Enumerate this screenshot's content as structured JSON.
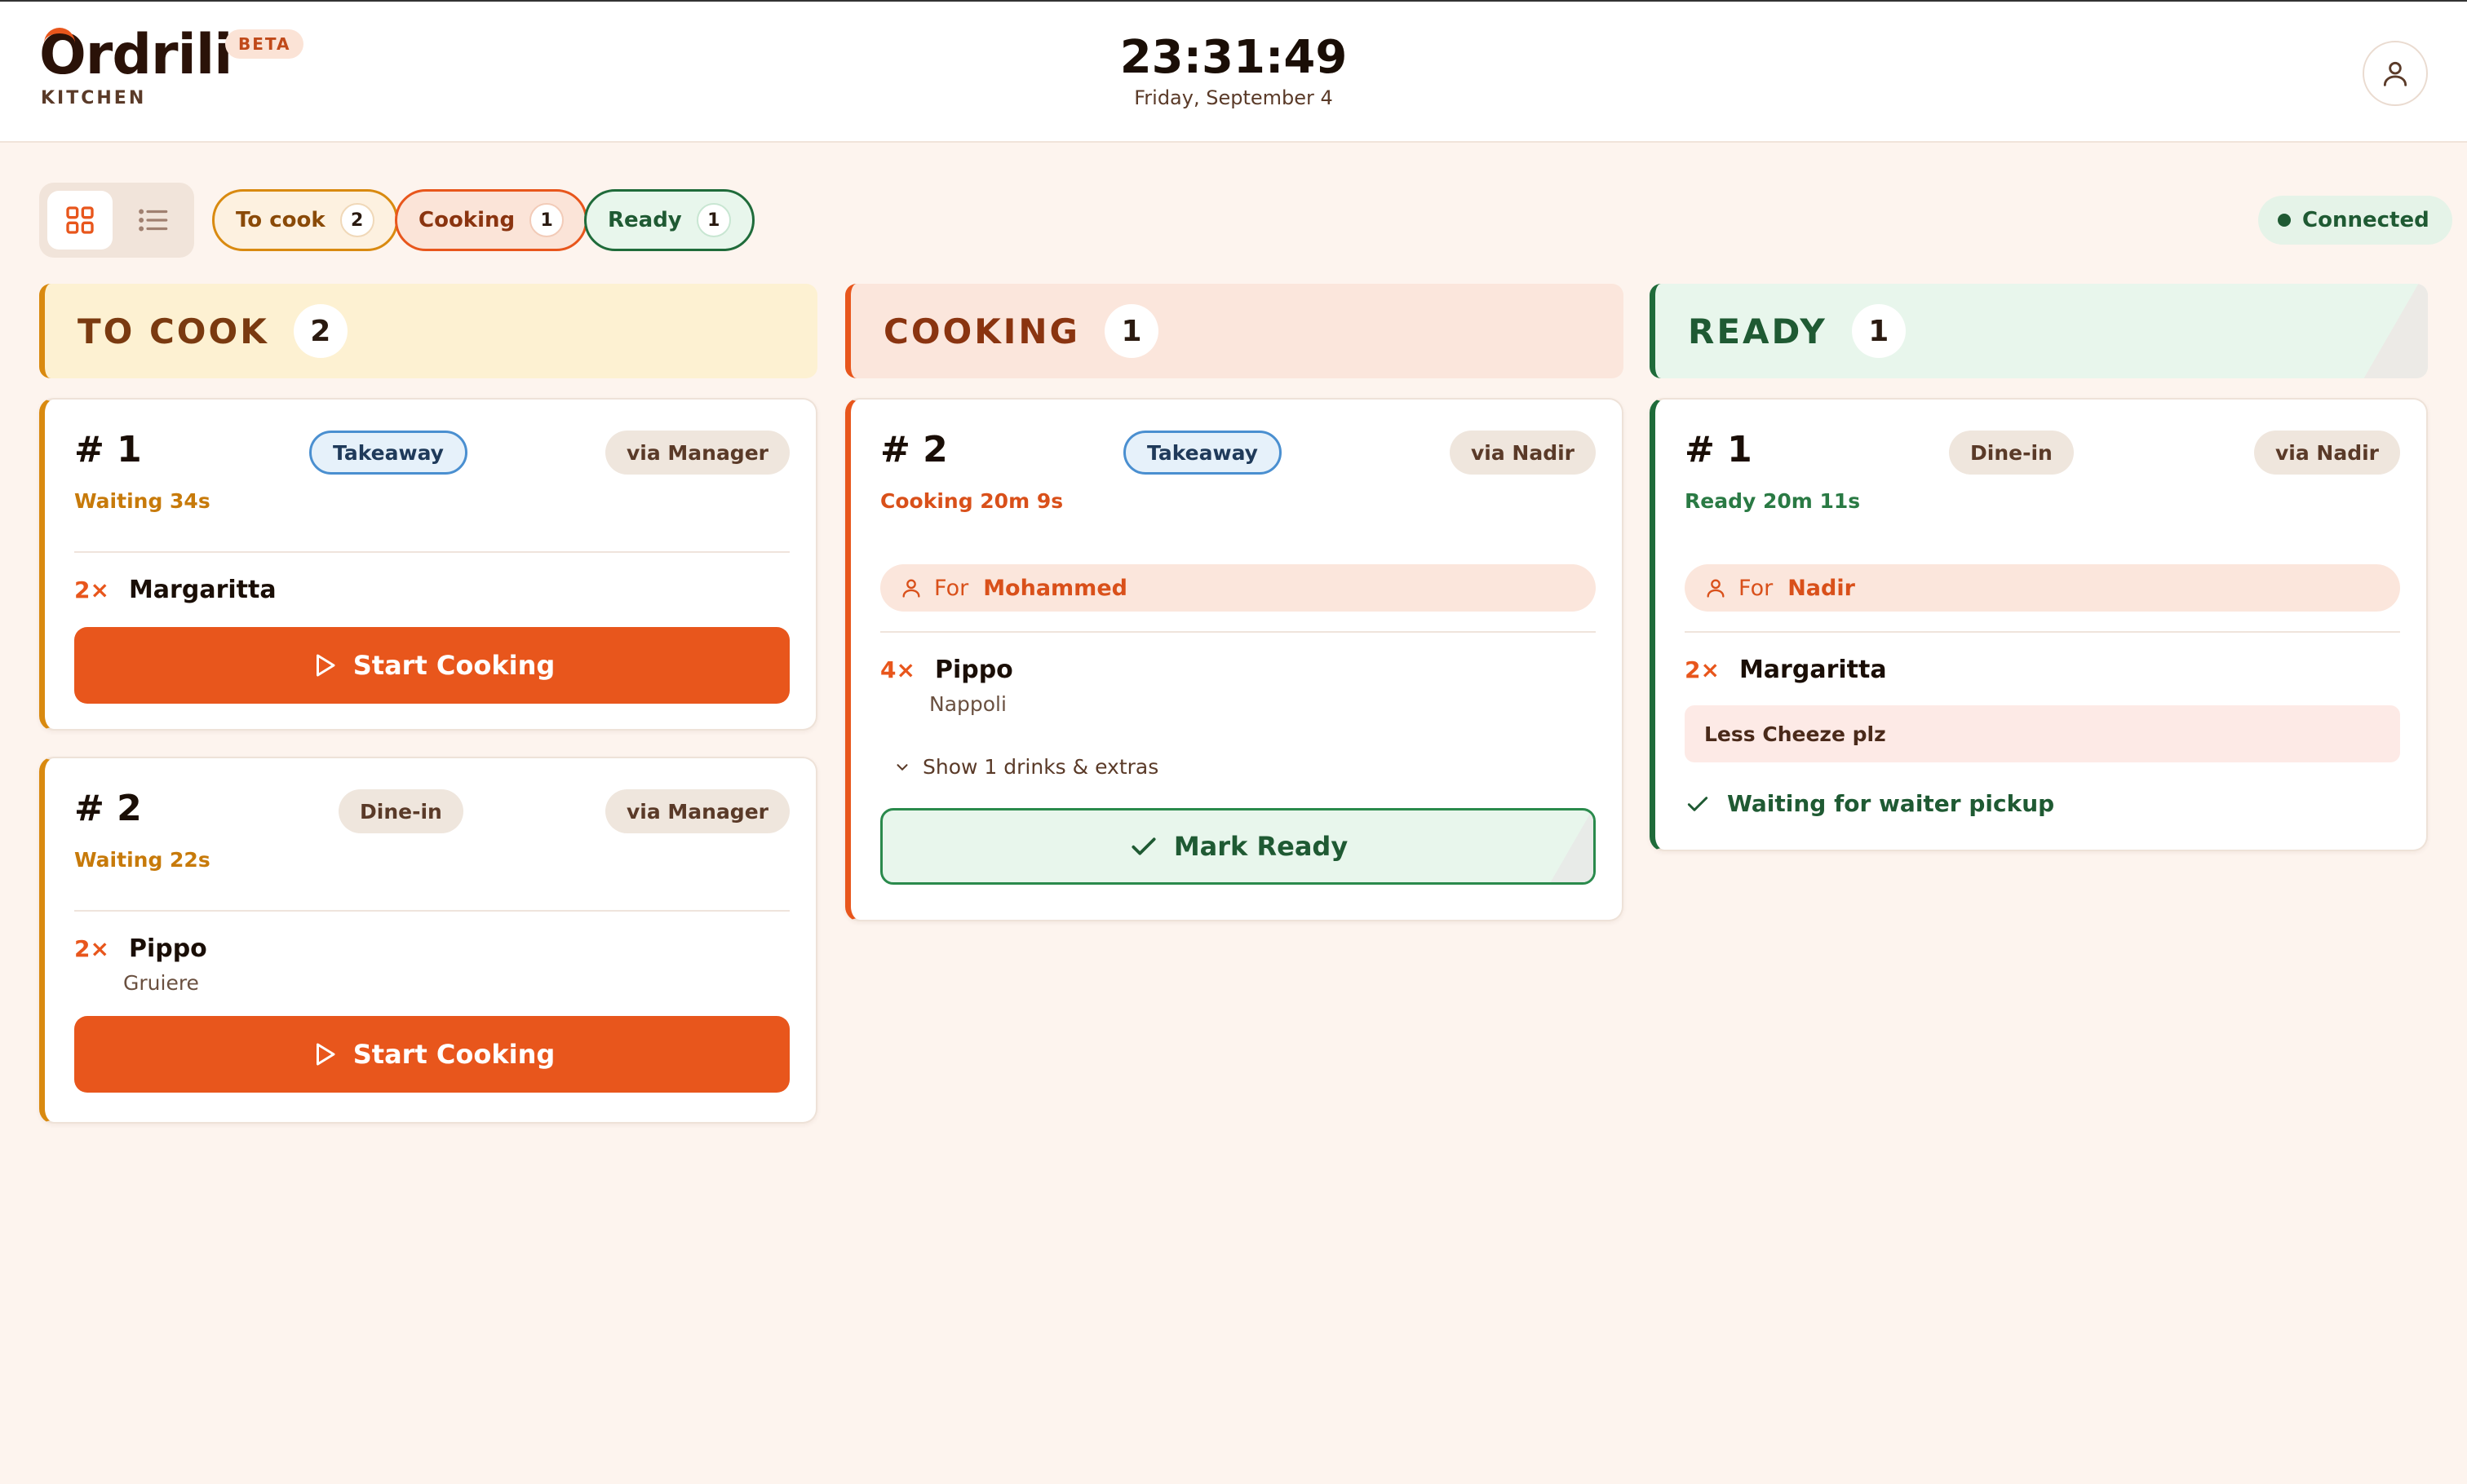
{
  "header": {
    "brand": "Ordrili",
    "beta": "BETA",
    "subtitle": "KITCHEN",
    "time": "23:31:49",
    "date": "Friday, September 4",
    "user_icon": "user-icon"
  },
  "toolbar": {
    "view_modes": [
      "grid-icon",
      "list-icon"
    ],
    "filters": [
      {
        "label": "To cook",
        "count": "2"
      },
      {
        "label": "Cooking",
        "count": "1"
      },
      {
        "label": "Ready",
        "count": "1"
      }
    ],
    "connection": "Connected"
  },
  "columns": {
    "tocook": {
      "title": "TO COOK",
      "count": "2"
    },
    "cooking": {
      "title": "COOKING",
      "count": "1"
    },
    "ready": {
      "title": "READY",
      "count": "1"
    }
  },
  "orders": {
    "tocook1": {
      "number": "# 1",
      "type": "Takeaway",
      "via": "via Manager",
      "status": "Waiting 34s",
      "items": [
        {
          "qty": "2×",
          "name": "Margaritta"
        }
      ],
      "action": "Start Cooking"
    },
    "tocook2": {
      "number": "# 2",
      "type": "Dine-in",
      "via": "via Manager",
      "status": "Waiting 22s",
      "items": [
        {
          "qty": "2×",
          "name": "Pippo",
          "sub": "Gruiere"
        }
      ],
      "action": "Start Cooking"
    },
    "cooking1": {
      "number": "# 2",
      "type": "Takeaway",
      "via": "via Nadir",
      "status": "Cooking 20m 9s",
      "for_label": "For",
      "for_name": "Mohammed",
      "items": [
        {
          "qty": "4×",
          "name": "Pippo",
          "sub": "Nappoli"
        }
      ],
      "extras": "Show 1 drinks & extras",
      "action": "Mark Ready"
    },
    "ready1": {
      "number": "# 1",
      "type": "Dine-in",
      "via": "via Nadir",
      "status": "Ready 20m 11s",
      "for_label": "For",
      "for_name": "Nadir",
      "items": [
        {
          "qty": "2×",
          "name": "Margaritta"
        }
      ],
      "note": "Less Cheeze plz",
      "pickup": "Waiting for waiter pickup"
    }
  },
  "colors": {
    "accent": "#e8561c",
    "tocook": "#d98a10",
    "ready": "#1f6b3a",
    "background": "#fdf4ee"
  }
}
